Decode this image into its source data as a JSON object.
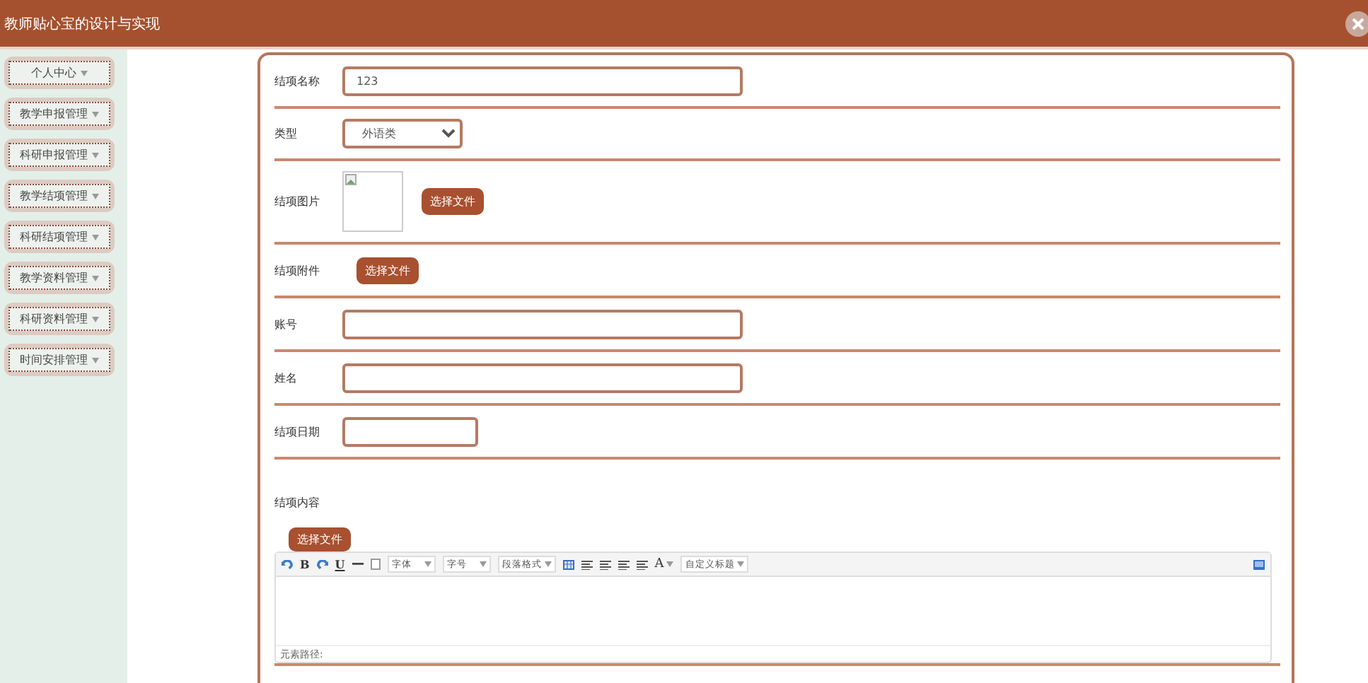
{
  "header": {
    "title": "教师贴心宝的设计与实现"
  },
  "sidebar": {
    "items": [
      {
        "label": "个人中心"
      },
      {
        "label": "教学申报管理"
      },
      {
        "label": "科研申报管理"
      },
      {
        "label": "教学结项管理"
      },
      {
        "label": "科研结项管理"
      },
      {
        "label": "教学资料管理"
      },
      {
        "label": "科研资料管理"
      },
      {
        "label": "时间安排管理"
      }
    ]
  },
  "form": {
    "fields": [
      {
        "kind": "text",
        "label": "结项名称",
        "value": "123"
      },
      {
        "kind": "select",
        "label": "类型",
        "value": "外语类"
      },
      {
        "kind": "image",
        "label": "结项图片",
        "button": "选择文件"
      },
      {
        "kind": "file",
        "label": "结项附件",
        "button": "选择文件"
      },
      {
        "kind": "text",
        "label": "账号"
      },
      {
        "kind": "text",
        "label": "姓名"
      },
      {
        "kind": "date",
        "label": "结项日期"
      },
      {
        "kind": "editor",
        "label": "结项内容",
        "button": "选择文件",
        "status": "元素路径:",
        "toolbar": [
          {
            "kind": "undo"
          },
          {
            "kind": "letter",
            "text": "B"
          },
          {
            "kind": "redo"
          },
          {
            "kind": "underline",
            "text": "U"
          },
          {
            "kind": "rule"
          },
          {
            "kind": "page"
          },
          {
            "kind": "dropdown",
            "text": "字体"
          },
          {
            "kind": "dropdown",
            "text": "字号"
          },
          {
            "kind": "dropdown",
            "text": "段落格式"
          },
          {
            "kind": "table"
          },
          {
            "kind": "align"
          },
          {
            "kind": "align"
          },
          {
            "kind": "align"
          },
          {
            "kind": "align"
          },
          {
            "kind": "color",
            "text": "A"
          },
          {
            "kind": "dropdown",
            "text": "自定义标题"
          }
        ]
      }
    ]
  }
}
